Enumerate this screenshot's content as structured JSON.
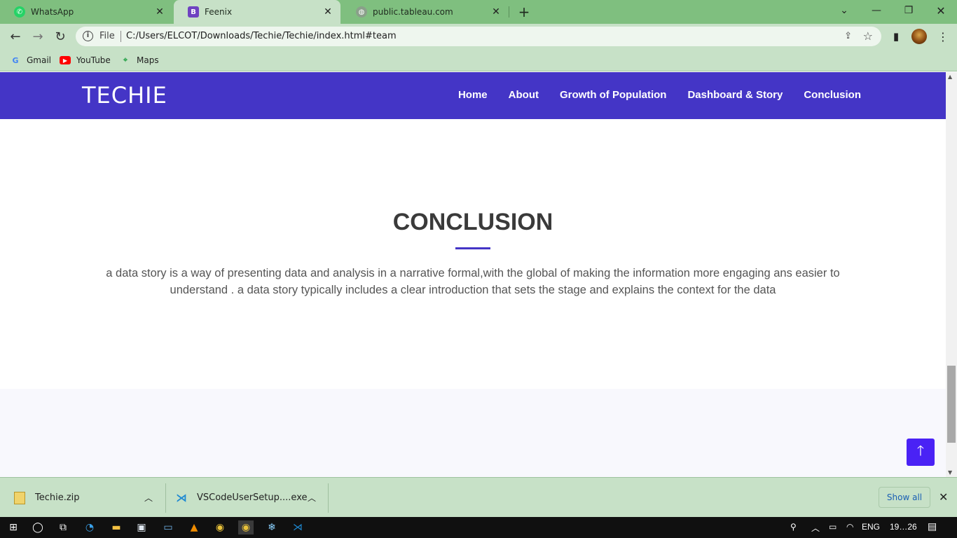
{
  "browser": {
    "tabs": [
      {
        "title": "WhatsApp",
        "favicon": "whatsapp-icon",
        "active": false
      },
      {
        "title": "Feenix",
        "favicon": "bootstrap-icon",
        "active": true
      },
      {
        "title": "public.tableau.com",
        "favicon": "globe-icon",
        "active": false
      }
    ],
    "address": {
      "scheme_label": "File",
      "url": "C:/Users/ELCOT/Downloads/Techie/Techie/index.html#team"
    },
    "bookmarks": [
      {
        "label": "Gmail",
        "icon": "google-icon"
      },
      {
        "label": "YouTube",
        "icon": "youtube-icon"
      },
      {
        "label": "Maps",
        "icon": "maps-icon"
      }
    ]
  },
  "site": {
    "brand": "TECHIE",
    "nav": [
      "Home",
      "About",
      "Growth of Population",
      "Dashboard & Story",
      "Conclusion"
    ],
    "section_title": "CONCLUSION",
    "section_text": "a data story is a way of presenting data and analysis in a narrative formal,with the global of making the information more engaging ans easier to understand . a data story typically includes a clear introduction that sets the stage and explains the context for the data",
    "accent_color": "#4435c6"
  },
  "downloads": {
    "items": [
      {
        "name": "Techie.zip",
        "icon": "zip-file-icon"
      },
      {
        "name": "VSCodeUserSetup....exe",
        "icon": "vscode-icon"
      }
    ],
    "show_all": "Show all"
  },
  "taskbar": {
    "language": "ENG",
    "time": "19…26"
  }
}
